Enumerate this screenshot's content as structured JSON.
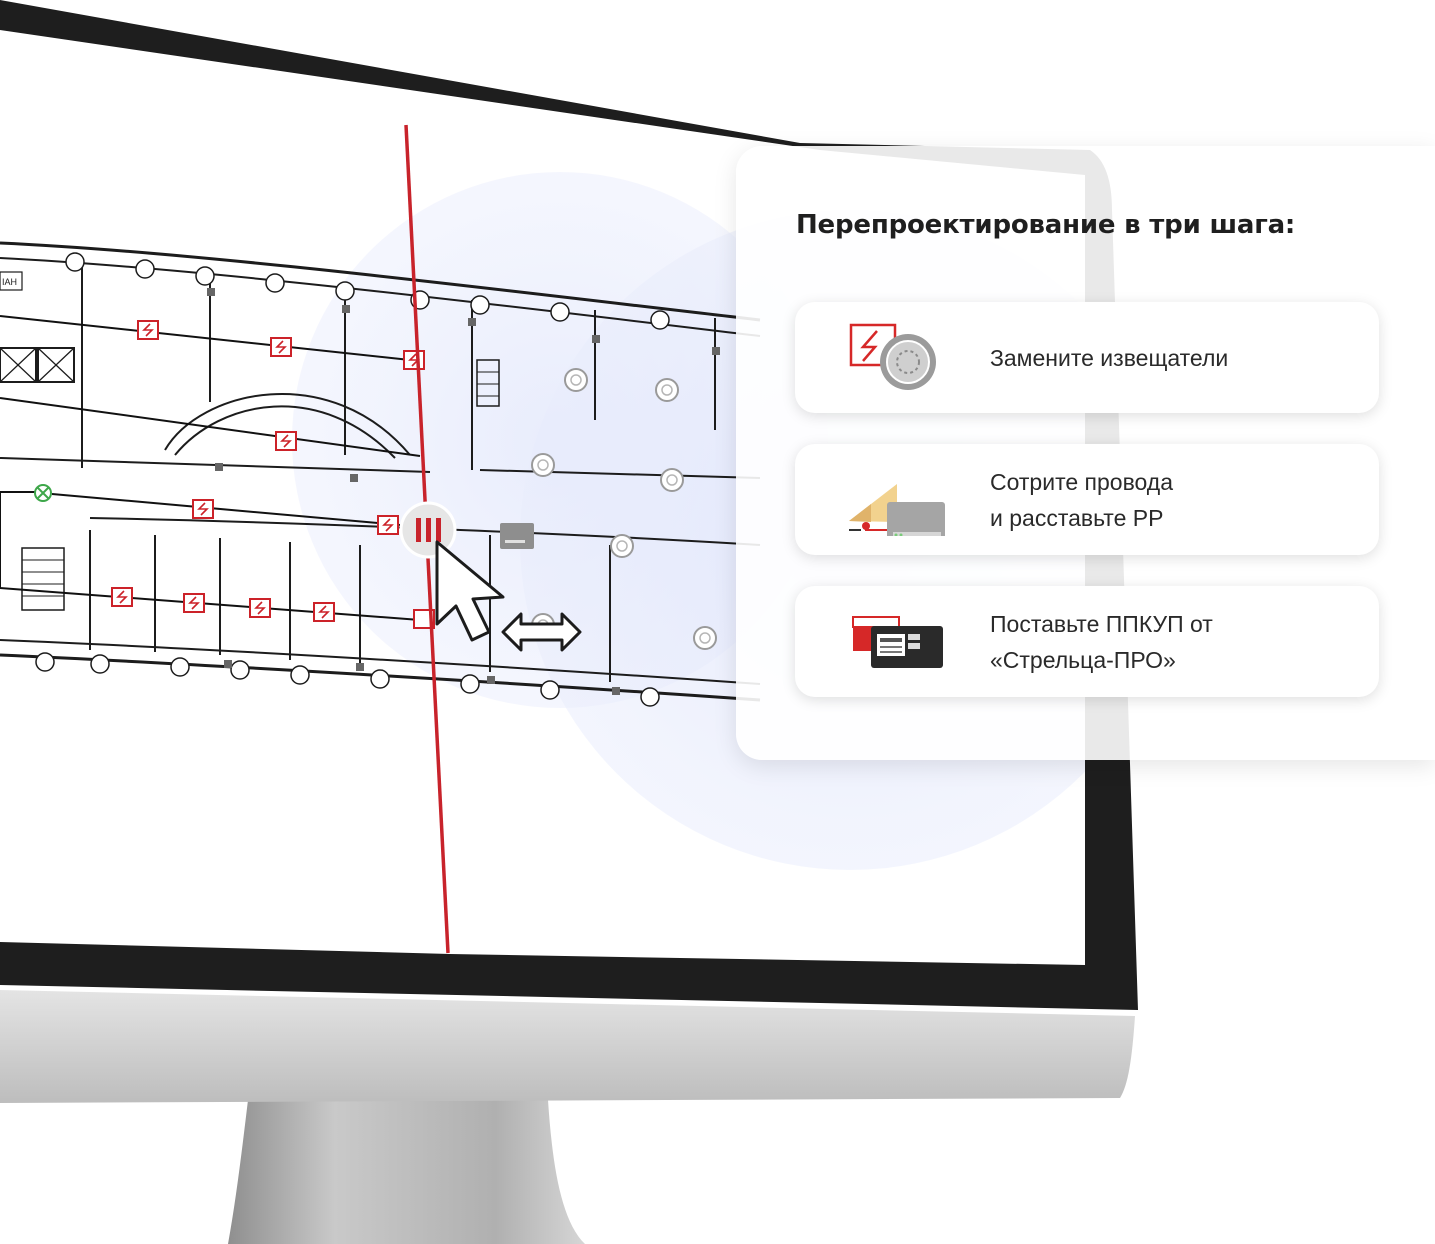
{
  "monitor": {
    "plan_labels": {
      "room_tag": "ІАН"
    }
  },
  "panel": {
    "title": "Перепроектирование в три шага:",
    "steps": [
      {
        "icon": "detector-replace-icon",
        "lines": [
          "Замените извещатели"
        ]
      },
      {
        "icon": "eraser-wires-icon",
        "lines": [
          "Сотрите провода",
          "и расставьте РР"
        ]
      },
      {
        "icon": "control-panel-icon",
        "lines": [
          "Поставьте ППКУП от",
          "«Стрельца-ПРО»"
        ]
      }
    ]
  },
  "colors": {
    "accent_red": "#d62828",
    "frame_black": "#1e1e1e",
    "aluminum": "#c8c8c8",
    "halo_blue": "#dfe5fb"
  }
}
